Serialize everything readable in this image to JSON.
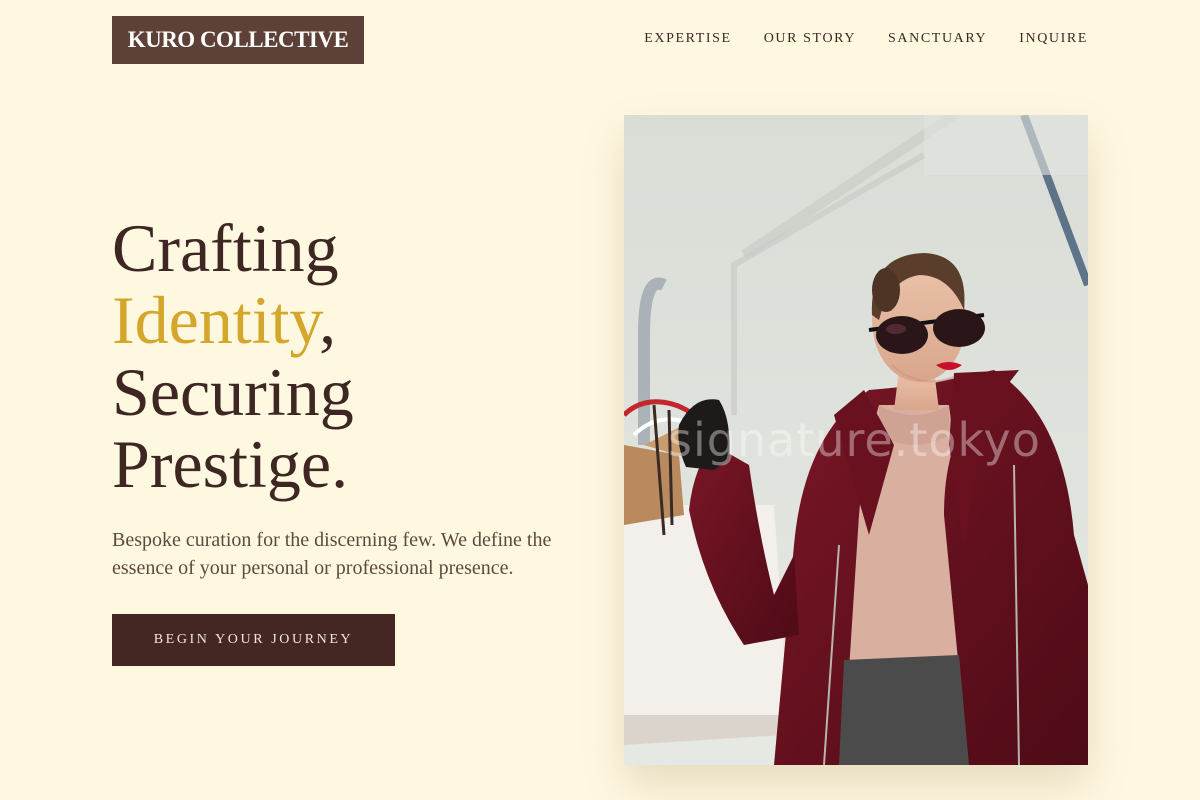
{
  "brand": {
    "logo_text": "KURO COLLECTIVE"
  },
  "nav": {
    "items": [
      {
        "label": "EXPERTISE"
      },
      {
        "label": "OUR STORY"
      },
      {
        "label": "SANCTUARY"
      },
      {
        "label": "INQUIRE"
      }
    ]
  },
  "hero": {
    "headline": {
      "line1": "Crafting",
      "line2_accent": "Identity",
      "line2_rest": ",",
      "line3": "Securing",
      "line4": "Prestige."
    },
    "tagline": "Bespoke curation for the discerning few. We define the essence of your personal or professional presence.",
    "cta_label": "BEGIN YOUR JOURNEY",
    "image": {
      "description": "Woman in sunglasses and burgundy coat holding shopping bags",
      "watermark": "signature.tokyo"
    }
  },
  "colors": {
    "background": "#FFF8E1",
    "logo_bg": "#5D4037",
    "text_dark": "#3E2723",
    "accent": "#D4A72C",
    "button_bg": "#442622"
  }
}
